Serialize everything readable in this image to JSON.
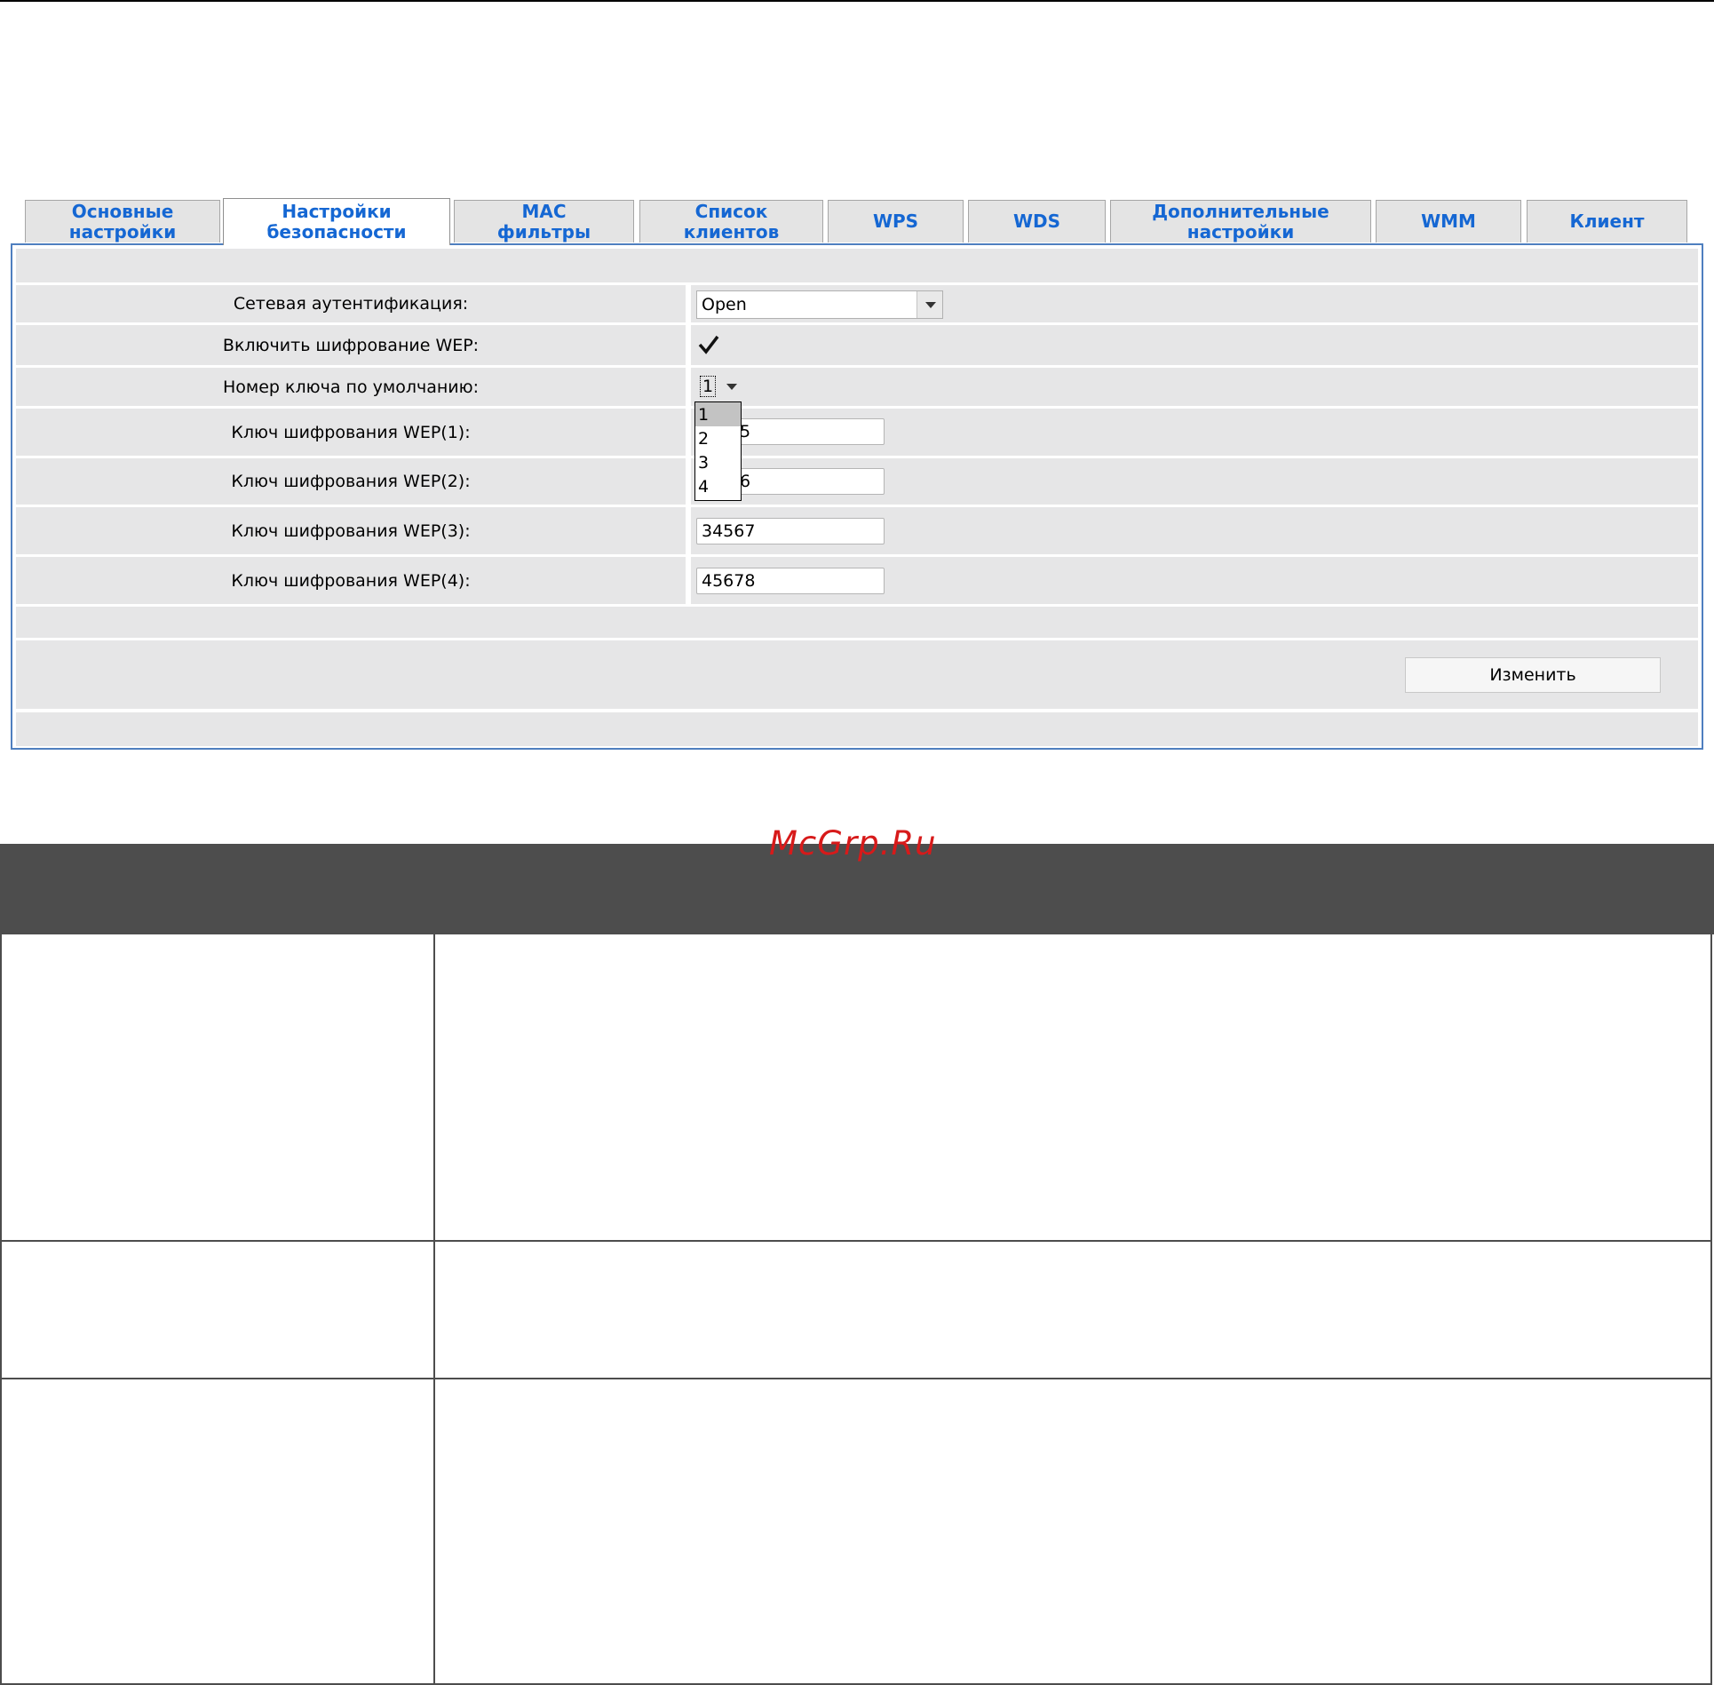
{
  "tabs": [
    {
      "label": "Основные\nнастройки"
    },
    {
      "label": "Настройки\nбезопасности"
    },
    {
      "label": "MAC\nфильтры"
    },
    {
      "label": "Список\nклиентов"
    },
    {
      "label": "WPS"
    },
    {
      "label": "WDS"
    },
    {
      "label": "Дополнительные\nнастройки"
    },
    {
      "label": "WMM"
    },
    {
      "label": "Клиент"
    }
  ],
  "form": {
    "auth_label": "Сетевая аутентификация:",
    "auth_value": "Open",
    "wep_enable_label": "Включить шифрование WEP:",
    "default_key_label": "Номер ключа по умолчанию:",
    "default_key_value": "1",
    "key1_label": "Ключ шифрования WEP(1):",
    "key1_value": "5",
    "key2_label": "Ключ шифрования WEP(2):",
    "key2_value": "6",
    "key3_label": "Ключ шифрования WEP(3):",
    "key3_value": "34567",
    "key4_label": "Ключ шифрования WEP(4):",
    "key4_value": "45678",
    "dropdown_options": [
      "1",
      "2",
      "3",
      "4"
    ],
    "submit_label": "Изменить"
  },
  "watermark": "McGrp.Ru",
  "colors": {
    "tab_text": "#1567d3",
    "panel_border": "#4f7fbf",
    "row_bg": "#e6e6e7",
    "table_header": "#4d4d4d"
  }
}
